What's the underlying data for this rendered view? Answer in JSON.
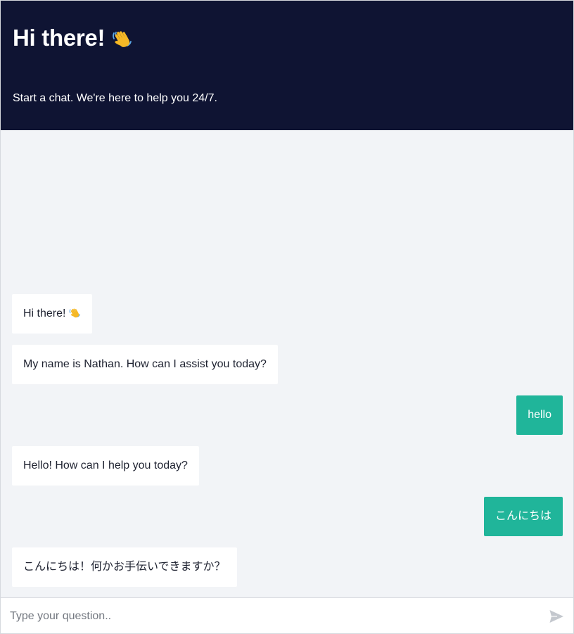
{
  "header": {
    "title": "Hi there!",
    "subtitle": "Start a chat. We're here to help you 24/7."
  },
  "messages": [
    {
      "sender": "bot",
      "text": "Hi there!",
      "icon": "waving-hand-icon"
    },
    {
      "sender": "bot",
      "text": "My name is Nathan. How can I assist you today?"
    },
    {
      "sender": "user",
      "text": "hello"
    },
    {
      "sender": "bot",
      "text": "Hello! How can I help you today?"
    },
    {
      "sender": "user",
      "text": "こんにちは"
    },
    {
      "sender": "bot",
      "text": "こんにちは！何かお手伝いできますか？"
    }
  ],
  "input": {
    "placeholder": "Type your question.."
  },
  "colors": {
    "header_bg": "#0f1433",
    "user_bubble": "#20b59a",
    "bot_bubble": "#ffffff",
    "chat_bg": "#f2f4f7"
  }
}
